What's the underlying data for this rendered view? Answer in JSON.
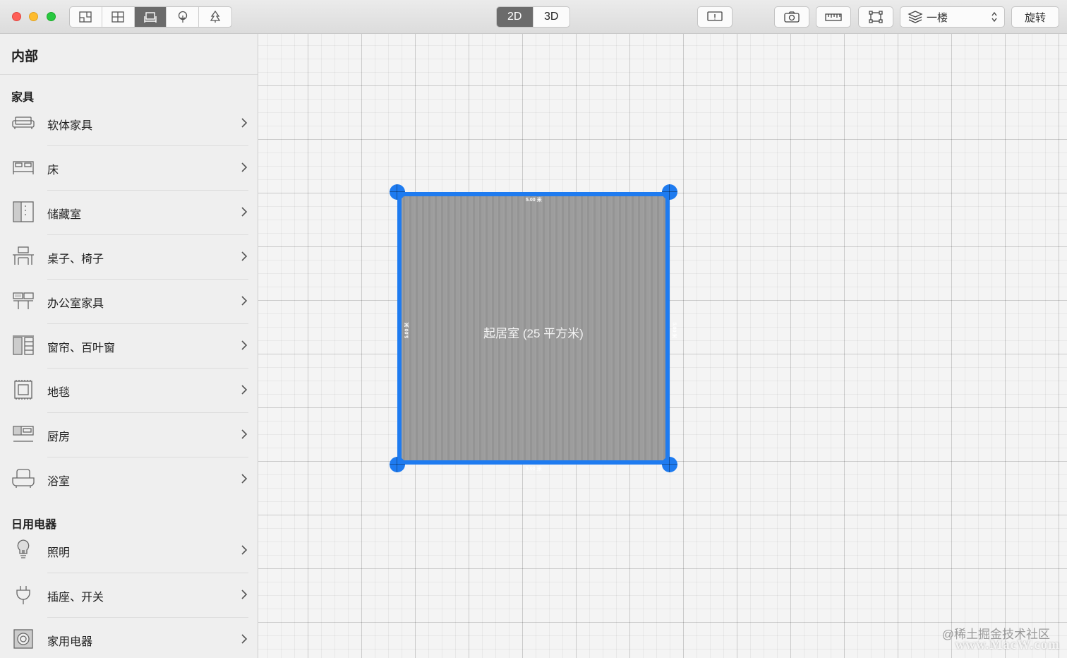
{
  "toolbar": {
    "view_modes": [
      {
        "icon": "floor-plan-icon"
      },
      {
        "icon": "window-grid-icon"
      },
      {
        "icon": "furniture-icon",
        "active": true
      },
      {
        "icon": "tree-icon"
      },
      {
        "icon": "pine-tree-icon"
      }
    ],
    "dimension": {
      "label_2d": "2D",
      "label_3d": "3D",
      "active": "2D"
    },
    "floor": {
      "label": "一楼"
    },
    "rotate_label": "旋转"
  },
  "sidebar": {
    "title": "内部",
    "sections": [
      {
        "header": "家具",
        "items": [
          {
            "label": "软体家具",
            "icon": "sofa-icon"
          },
          {
            "label": "床",
            "icon": "bed-icon"
          },
          {
            "label": "储藏室",
            "icon": "cabinet-icon"
          },
          {
            "label": "桌子、椅子",
            "icon": "table-chair-icon"
          },
          {
            "label": "办公室家具",
            "icon": "office-desk-icon"
          },
          {
            "label": "窗帘、百叶窗",
            "icon": "curtain-icon"
          },
          {
            "label": "地毯",
            "icon": "rug-icon"
          },
          {
            "label": "厨房",
            "icon": "kitchen-icon"
          },
          {
            "label": "浴室",
            "icon": "bathtub-icon"
          }
        ]
      },
      {
        "header": "日用电器",
        "items": [
          {
            "label": "照明",
            "icon": "lightbulb-icon"
          },
          {
            "label": "插座、开关",
            "icon": "plug-icon"
          },
          {
            "label": "家用电器",
            "icon": "appliance-icon"
          }
        ]
      }
    ]
  },
  "canvas": {
    "room_label": "起居室 (25 平方米)",
    "measurements": {
      "top": "5.00 米",
      "bottom": "5.00 米",
      "left": "5.00 米",
      "right": "5.00 米"
    }
  },
  "watermark": {
    "line1": "@稀土掘金技术社区",
    "line2": "www.MacW.com"
  },
  "colors": {
    "accent": "#1e7bf0",
    "active_segment": "#6b6b6b"
  }
}
